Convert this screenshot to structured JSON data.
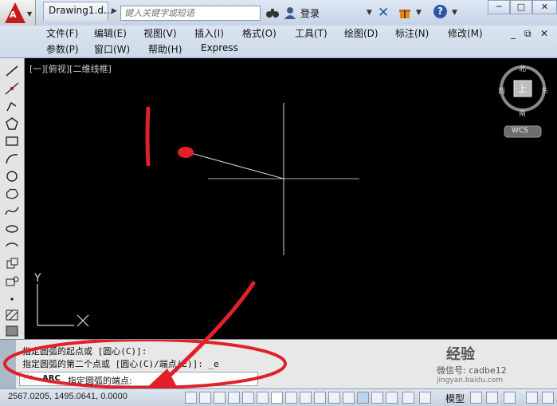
{
  "titlebar": {
    "doc_tab": "Drawing1.d...",
    "search_placeholder": "键入关键字或短语",
    "login": "登录"
  },
  "menu": {
    "row1": [
      "文件(F)",
      "编辑(E)",
      "视图(V)",
      "插入(I)",
      "格式(O)",
      "工具(T)",
      "绘图(D)",
      "标注(N)",
      "修改(M)"
    ],
    "row2": [
      "参数(P)",
      "窗口(W)",
      "帮助(H)",
      "Express"
    ]
  },
  "viewport": {
    "label": "[一][俯视][二维线框]",
    "viewcube": {
      "north": "北",
      "south": "南",
      "east": "东",
      "west": "西",
      "top": "上",
      "wcs": "WCS"
    },
    "ucs": {
      "y": "Y",
      "x": "X"
    }
  },
  "command": {
    "line1": "指定圆弧的起点或 [圆心(C)]:",
    "line2": "指定圆弧的第二个点或 [圆心(C)/端点(E)]: _e",
    "prompt_cmd": "ARC",
    "prompt_text": "指定圆弧的端点:"
  },
  "statusbar": {
    "coords": "2567.0205, 1495.0641, 0.0000",
    "model": "模型"
  },
  "watermark": {
    "text": "经验",
    "sub": "微信号: cadbe12",
    "url": "jingyan.baidu.com"
  },
  "colors": {
    "accent_red": "#e0202a",
    "canvas": "#000000",
    "crosshair_h": "#c8a07a"
  }
}
